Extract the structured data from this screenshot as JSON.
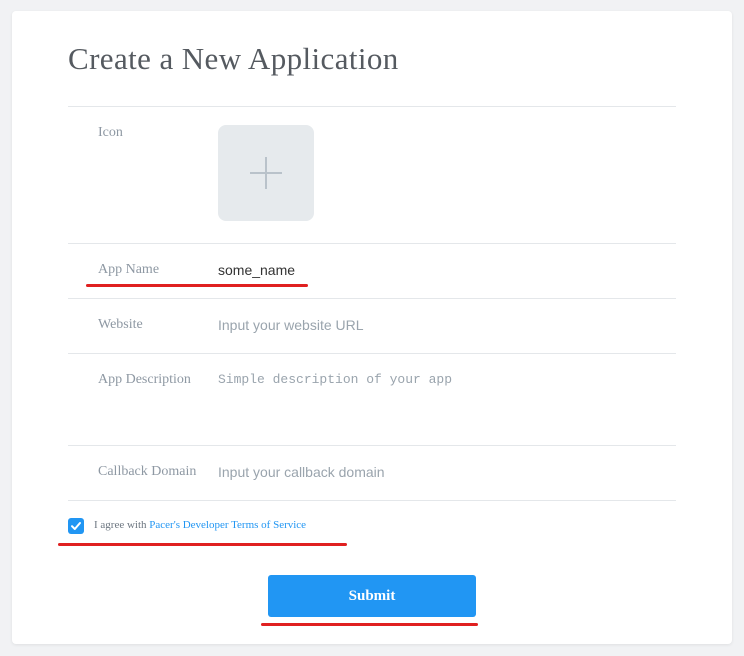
{
  "page": {
    "title": "Create a New Application"
  },
  "form": {
    "icon_label": "Icon",
    "app_name_label": "App Name",
    "app_name_value": "some_name",
    "website_label": "Website",
    "website_placeholder": "Input your website URL",
    "description_label": "App Description",
    "description_placeholder": "Simple description of your app",
    "callback_label": "Callback Domain",
    "callback_placeholder": "Input your callback domain"
  },
  "agreement": {
    "checked": true,
    "prefix": "I agree with ",
    "link_text": "Pacer's Developer Terms of Service"
  },
  "submit_label": "Submit",
  "colors": {
    "accent": "#2196f3",
    "annotation": "#e02020"
  }
}
